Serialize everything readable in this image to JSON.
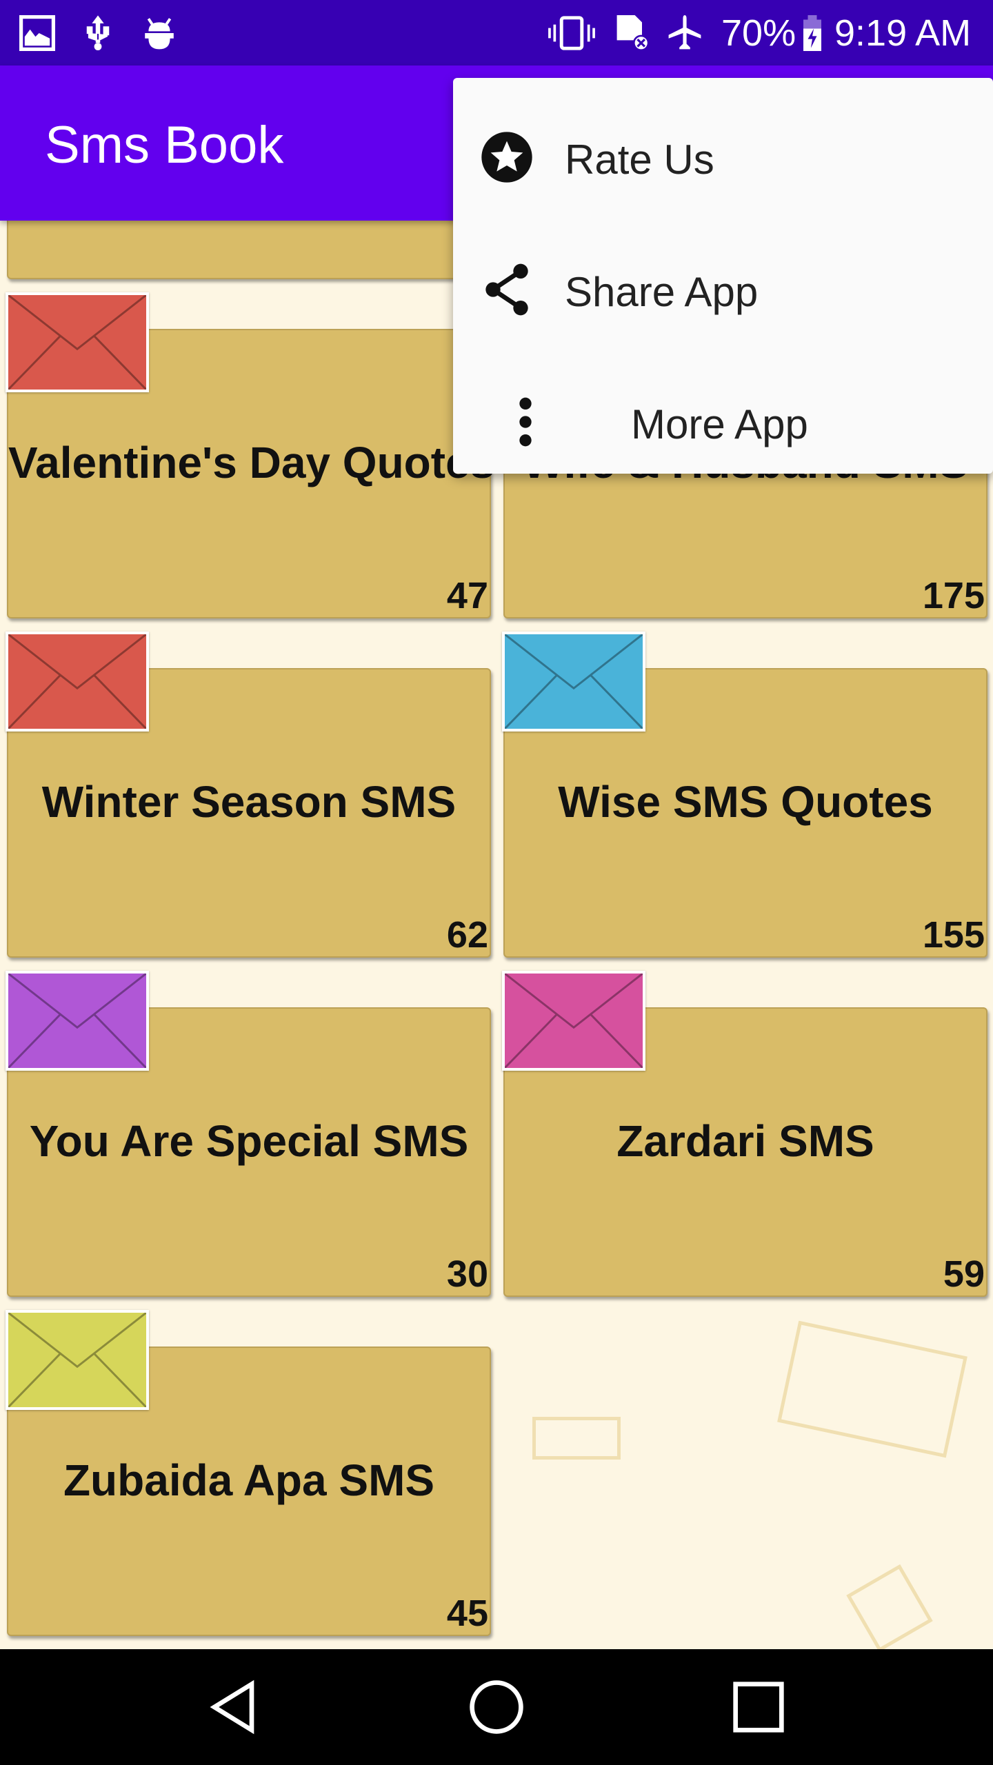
{
  "status_bar": {
    "icons": [
      "image-icon",
      "usb-icon",
      "android-debug-icon",
      "vibrate-icon",
      "no-sim-icon",
      "airplane-icon",
      "battery-charging-icon"
    ],
    "battery": "70%",
    "time": "9:19 AM"
  },
  "app_bar": {
    "title": "Sms Book"
  },
  "colors": {
    "status_bar": "#3700b3",
    "app_bar": "#6200ee",
    "card": "#d9bc68",
    "background": "#fdf6e3"
  },
  "cards": [
    {
      "name": "",
      "count": "",
      "envelope": "#d9584c"
    },
    {
      "name": "",
      "count": "",
      "envelope": "#d9584c"
    },
    {
      "name": "Valentine's Day Quotes",
      "count": "47",
      "envelope": "#d9584c"
    },
    {
      "name": "Wife & Husband SMS",
      "count": "175",
      "envelope": "#d9584c"
    },
    {
      "name": "Winter Season SMS",
      "count": "62",
      "envelope": "#d9584c"
    },
    {
      "name": "Wise SMS Quotes",
      "count": "155",
      "envelope": "#4ab3d9"
    },
    {
      "name": "You Are Special SMS",
      "count": "30",
      "envelope": "#b057d6"
    },
    {
      "name": "Zardari SMS",
      "count": "59",
      "envelope": "#d6519e"
    },
    {
      "name": "Zubaida Apa SMS",
      "count": "45",
      "envelope": "#d6d65a"
    }
  ],
  "menu": {
    "items": [
      {
        "label": "Rate Us",
        "icon": "star-circle-icon"
      },
      {
        "label": "Share App",
        "icon": "share-icon"
      },
      {
        "label": "More App",
        "icon": "more-vert-icon"
      }
    ]
  },
  "nav_bar": {
    "buttons": [
      "back-icon",
      "home-icon",
      "recents-icon"
    ]
  }
}
